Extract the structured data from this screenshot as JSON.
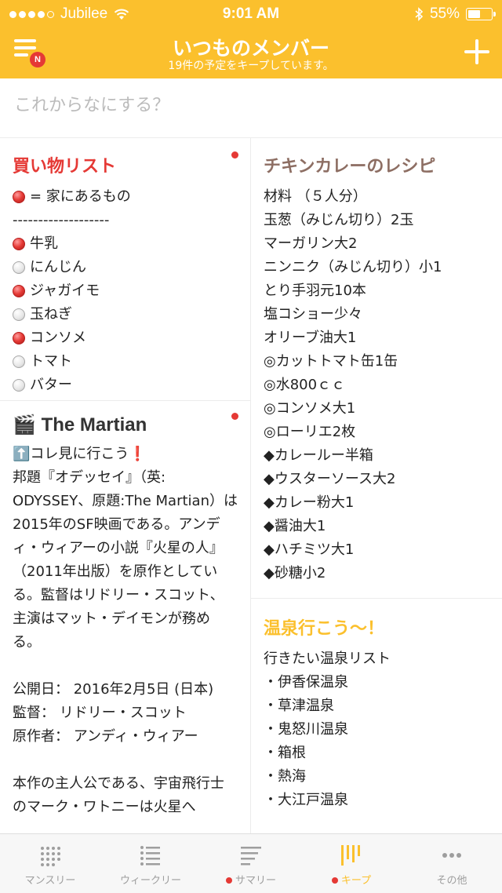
{
  "status_bar": {
    "carrier": "Jubilee",
    "time": "9:01 AM",
    "battery": "55%",
    "battery_level": 0.55
  },
  "header": {
    "title": "いつものメンバー",
    "subtitle": "19件の予定をキープしています。",
    "menu_badge": "N",
    "accent_color": "#FBC02D"
  },
  "compose": {
    "placeholder": "これからなにする？"
  },
  "cards": {
    "shopping": {
      "title": "買い物リスト",
      "title_color": "#E53935",
      "legend": "= 家にあるもの",
      "separator": "-------------------",
      "items": [
        {
          "label": "牛乳",
          "state": "red"
        },
        {
          "label": "にんじん",
          "state": "grey"
        },
        {
          "label": "ジャガイモ",
          "state": "red"
        },
        {
          "label": "玉ねぎ",
          "state": "grey"
        },
        {
          "label": "コンソメ",
          "state": "red"
        },
        {
          "label": "トマト",
          "state": "grey"
        },
        {
          "label": "バター",
          "state": "grey"
        }
      ]
    },
    "martian": {
      "icon": "🎬",
      "title": "The Martian",
      "title_color": "#333333",
      "body": "⬆️コレ見に行こう❗\n邦題『オデッセイ』（英: ODYSSEY、原題:The Martian）は2015年のSF映画である。アンディ・ウィアーの小説『火星の人』（2011年出版）を原作としている。監督はリドリー・スコット、主演はマット・デイモンが務める。\n\n公開日： 2016年2月5日 (日本)\n監督： リドリー・スコット\n原作者： アンディ・ウィアー\n\n本作の主人公である、宇宙飛行士のマーク・ワトニーは火星へ"
    },
    "curry": {
      "title": "チキンカレーのレシピ",
      "title_color": "#8D6E63",
      "lines": [
        "材料 （５人分）",
        "玉葱（みじん切り）2玉",
        "マーガリン大2",
        "ニンニク（みじん切り）小1",
        "とり手羽元10本",
        "塩コショー少々",
        "オリーブ油大1",
        "◎カットトマト缶1缶",
        "◎水800ｃｃ",
        "◎コンソメ大1",
        "◎ローリエ2枚",
        "◆カレールー半箱",
        "◆ウスターソース大2",
        "◆カレー粉大1",
        "◆醤油大1",
        "◆ハチミツ大1",
        "◆砂糖小2"
      ]
    },
    "onsen": {
      "title": "温泉行こう〜！",
      "title_color": "#FBC02D",
      "lines": [
        "行きたい温泉リスト",
        "・伊香保温泉",
        "・草津温泉",
        "・鬼怒川温泉",
        "・箱根",
        "・熱海",
        "・大江戸温泉"
      ]
    }
  },
  "tabbar": {
    "tabs": [
      {
        "label": "マンスリー",
        "icon": "monthly-grid-icon",
        "active": false,
        "dot": false
      },
      {
        "label": "ウィークリー",
        "icon": "weekly-list-icon",
        "active": false,
        "dot": false
      },
      {
        "label": "サマリー",
        "icon": "summary-lines-icon",
        "active": false,
        "dot": true
      },
      {
        "label": "キープ",
        "icon": "keep-columns-icon",
        "active": true,
        "dot": true
      },
      {
        "label": "その他",
        "icon": "more-dots-icon",
        "active": false,
        "dot": false
      }
    ],
    "active_color": "#FBC02D",
    "inactive_color": "#9E9E9E"
  }
}
